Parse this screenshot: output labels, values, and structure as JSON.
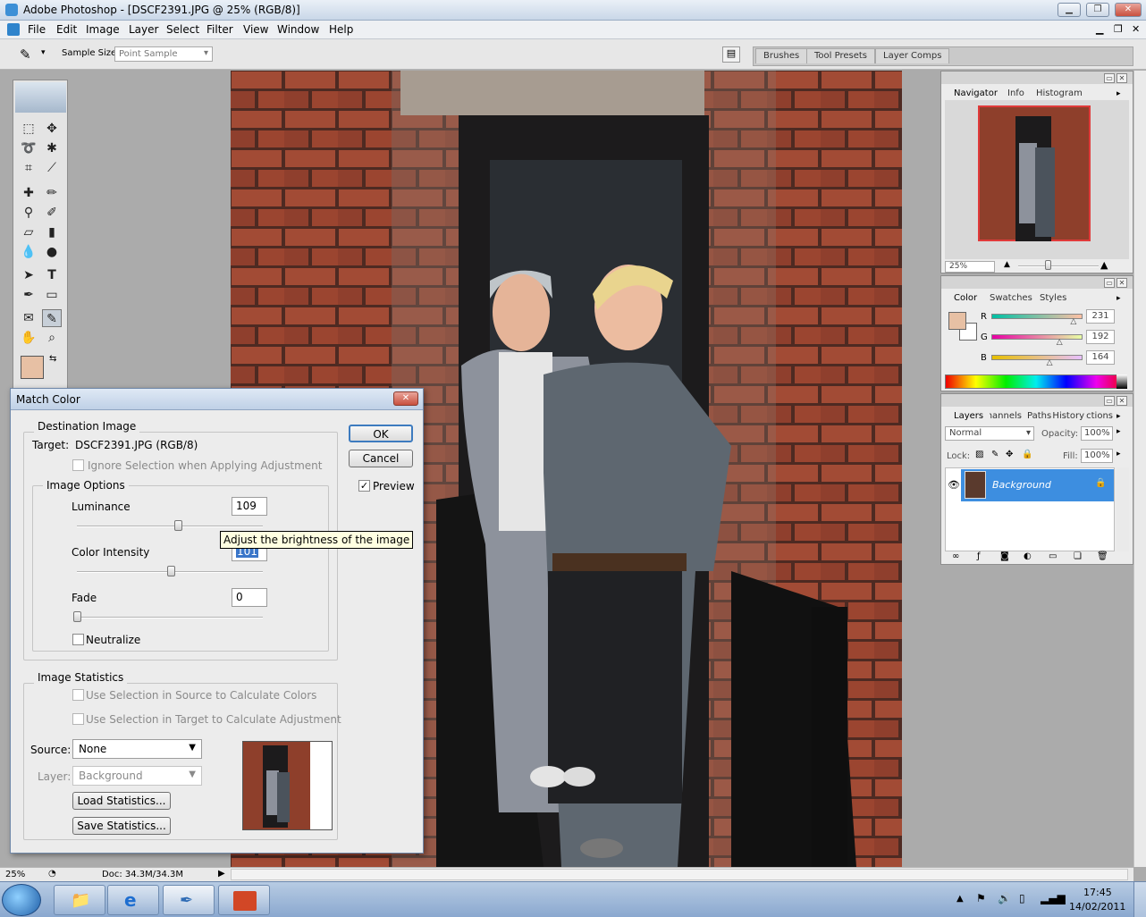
{
  "window": {
    "title": "Adobe Photoshop - [DSCF2391.JPG @ 25% (RGB/8)]"
  },
  "menu": [
    "File",
    "Edit",
    "Image",
    "Layer",
    "Select",
    "Filter",
    "View",
    "Window",
    "Help"
  ],
  "options": {
    "sample_size_label": "Sample Size:",
    "sample_size_value": "Point Sample"
  },
  "palette_well": {
    "tabs": [
      "Brushes",
      "Tool Presets",
      "Layer Comps"
    ]
  },
  "navigator": {
    "tabs": [
      "Navigator",
      "Info",
      "Histogram"
    ],
    "zoom": "25%"
  },
  "color_panel": {
    "tabs": [
      "Color",
      "Swatches",
      "Styles"
    ],
    "foreground": "#e7c0a4",
    "channels": [
      {
        "label": "R",
        "value": "231",
        "level": 0.906
      },
      {
        "label": "G",
        "value": "192",
        "level": 0.753
      },
      {
        "label": "B",
        "value": "164",
        "level": 0.643
      }
    ]
  },
  "layers": {
    "tabs": [
      "Layers",
      "Channels",
      "Paths",
      "History",
      "Actions"
    ],
    "blend_mode": "Normal",
    "opacity_label": "Opacity:",
    "opacity": "100%",
    "lock_label": "Lock:",
    "fill_label": "Fill:",
    "fill": "100%",
    "layer_name": "Background"
  },
  "match_color": {
    "title": "Match Color",
    "destination_group": "Destination Image",
    "target_label": "Target:",
    "target_value": "DSCF2391.JPG (RGB/8)",
    "ignore_selection": "Ignore Selection when Applying Adjustment",
    "image_options_group": "Image Options",
    "luminance_label": "Luminance",
    "luminance_value": "109",
    "luminance_level": 0.545,
    "tooltip": "Adjust the brightness of the image",
    "color_intensity_label": "Color Intensity",
    "color_intensity_value": "101",
    "color_intensity_level": 0.505,
    "fade_label": "Fade",
    "fade_value": "0",
    "fade_level": 0.0,
    "neutralize_label": "Neutralize",
    "statistics_group": "Image Statistics",
    "use_source_selection": "Use Selection in Source to Calculate Colors",
    "use_target_selection": "Use Selection in Target to Calculate Adjustment",
    "source_label": "Source:",
    "source_value": "None",
    "layer_label": "Layer:",
    "layer_value": "Background",
    "load_button": "Load Statistics...",
    "save_button": "Save Statistics...",
    "ok_button": "OK",
    "cancel_button": "Cancel",
    "preview_label": "Preview"
  },
  "status": {
    "zoom": "25%",
    "doc": "Doc: 34.3M/34.3M"
  },
  "taskbar": {
    "time": "17:45",
    "date": "14/02/2011"
  }
}
